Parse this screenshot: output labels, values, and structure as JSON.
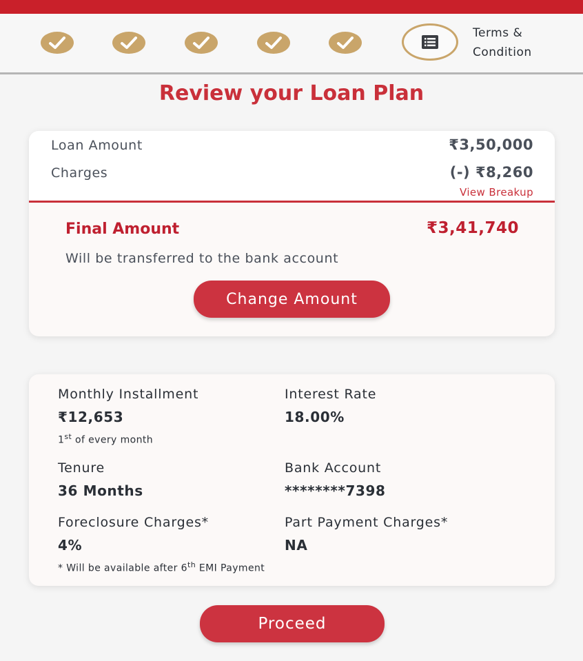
{
  "stepper": {
    "completed_steps": 5,
    "current_step_label": "Terms & Condition",
    "step_icon": "check-icon",
    "current_icon": "list-icon",
    "colors": {
      "completed": "#c9a56a",
      "accent": "#c9202a"
    }
  },
  "page": {
    "title": "Review your Loan Plan"
  },
  "summary": {
    "loan_amount_label": "Loan Amount",
    "loan_amount_value": "₹3,50,000",
    "charges_label": "Charges",
    "charges_value": "(-) ₹8,260",
    "view_breakup_link": "View Breakup",
    "final_amount_label": "Final Amount",
    "final_amount_value": "₹3,41,740",
    "final_amount_note": "Will be transferred to the bank account",
    "change_amount_button": "Change Amount"
  },
  "details": {
    "monthly_installment_label": "Monthly Installment",
    "monthly_installment_value": "₹12,653",
    "installment_due_day": "1",
    "installment_due_suffix": "st",
    "installment_due_rest": " of every month",
    "interest_rate_label": "Interest Rate",
    "interest_rate_value": "18.00%",
    "tenure_label": "Tenure",
    "tenure_value": "36 Months",
    "bank_account_label": "Bank Account",
    "bank_account_value": "********7398",
    "foreclosure_label": "Foreclosure Charges*",
    "foreclosure_value": "4%",
    "part_payment_label": "Part Payment Charges*",
    "part_payment_value": "NA",
    "footnote_prefix": "* Will be available after 6",
    "footnote_suffix_sup": "th",
    "footnote_rest": " EMI Payment"
  },
  "footer": {
    "proceed_button": "Proceed"
  }
}
